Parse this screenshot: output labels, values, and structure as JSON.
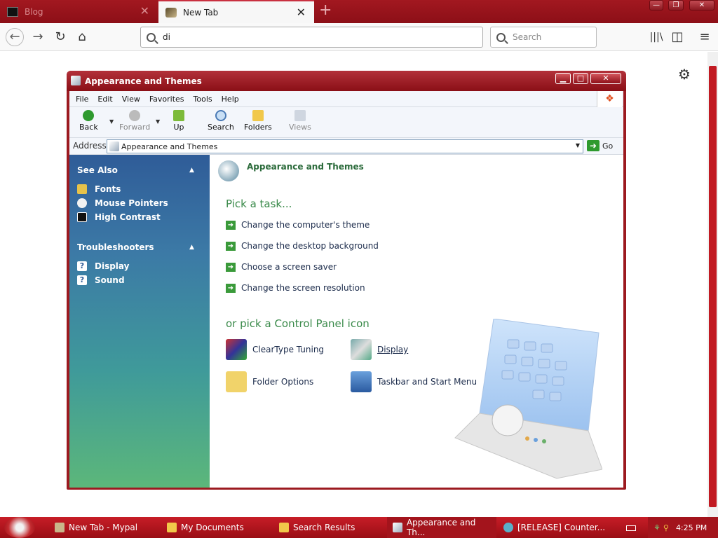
{
  "browser": {
    "tabs": [
      {
        "label": "Blog"
      },
      {
        "label": "New Tab"
      }
    ],
    "url_value": "di",
    "search_placeholder": "Search"
  },
  "window": {
    "title": "Appearance and Themes",
    "menu": [
      "File",
      "Edit",
      "View",
      "Favorites",
      "Tools",
      "Help"
    ],
    "toolbar": {
      "back": "Back",
      "forward": "Forward",
      "up": "Up",
      "search": "Search",
      "folders": "Folders",
      "views": "Views"
    },
    "address": {
      "label": "Address",
      "value": "Appearance and Themes",
      "go": "Go"
    }
  },
  "leftpane": {
    "see_also": {
      "title": "See Also",
      "items": [
        "Fonts",
        "Mouse Pointers",
        "High Contrast"
      ]
    },
    "troubleshooters": {
      "title": "Troubleshooters",
      "items": [
        "Display",
        "Sound"
      ]
    }
  },
  "content": {
    "title": "Appearance and Themes",
    "pick_task": "Pick a task...",
    "tasks": [
      "Change the computer's theme",
      "Change the desktop background",
      "Choose a screen saver",
      "Change the screen resolution"
    ],
    "or_pick": "or pick a Control Panel icon",
    "icons": [
      "ClearType Tuning",
      "Display",
      "Folder Options",
      "Taskbar and Start Menu"
    ]
  },
  "taskbar": {
    "items": [
      "New Tab - Mypal",
      "My Documents",
      "Search Results",
      "Appearance and Th...",
      "[RELEASE] Counter..."
    ],
    "clock": "4:25 PM"
  },
  "colors": {
    "accent": "#a21820",
    "link_green": "#3a8a4a"
  }
}
